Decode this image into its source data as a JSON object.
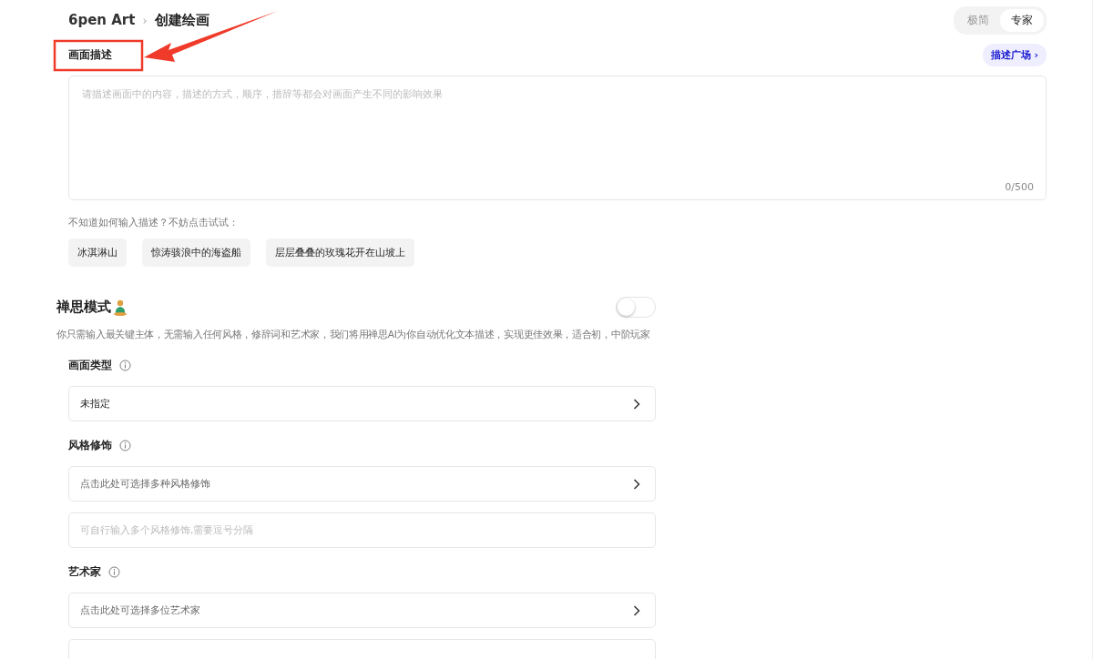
{
  "breadcrumb": {
    "root": "6pen Art",
    "separator": "›",
    "current": "创建绘画"
  },
  "mode_switch": [
    {
      "label": "极简",
      "selected": false
    },
    {
      "label": "专家",
      "selected": true
    }
  ],
  "description": {
    "label": "画面描述",
    "gallery_link": "描述广场 ›",
    "placeholder": "请描述画面中的内容，描述的方式，顺序，措辞等都会对画面产生不同的影响效果",
    "counter": "0/500"
  },
  "suggestions": {
    "hint": "不知道如何输入描述？不妨点击试试：",
    "items": [
      "冰淇淋山",
      "惊涛骇浪中的海盗船",
      "层层叠叠的玫瑰花开在山坡上"
    ]
  },
  "zen_mode": {
    "title": "禅思模式",
    "on": false,
    "description": "你只需输入最关键主体，无需输入任何风格，修辞词和艺术家，我们将用禅思AI为你自动优化文本描述，实现更佳效果，适合初，中阶玩家"
  },
  "sections": [
    {
      "label": "画面类型",
      "rows": [
        {
          "kind": "select",
          "text": "未指定",
          "empty": false
        }
      ]
    },
    {
      "label": "风格修饰",
      "rows": [
        {
          "kind": "select",
          "text": "点击此处可选择多种风格修饰",
          "empty": true
        },
        {
          "kind": "input",
          "placeholder": "可自行输入多个风格修饰,需要逗号分隔"
        }
      ]
    },
    {
      "label": "艺术家",
      "rows": [
        {
          "kind": "select",
          "text": "点击此处可选择多位艺术家",
          "empty": true
        },
        {
          "kind": "stub"
        }
      ]
    }
  ]
}
